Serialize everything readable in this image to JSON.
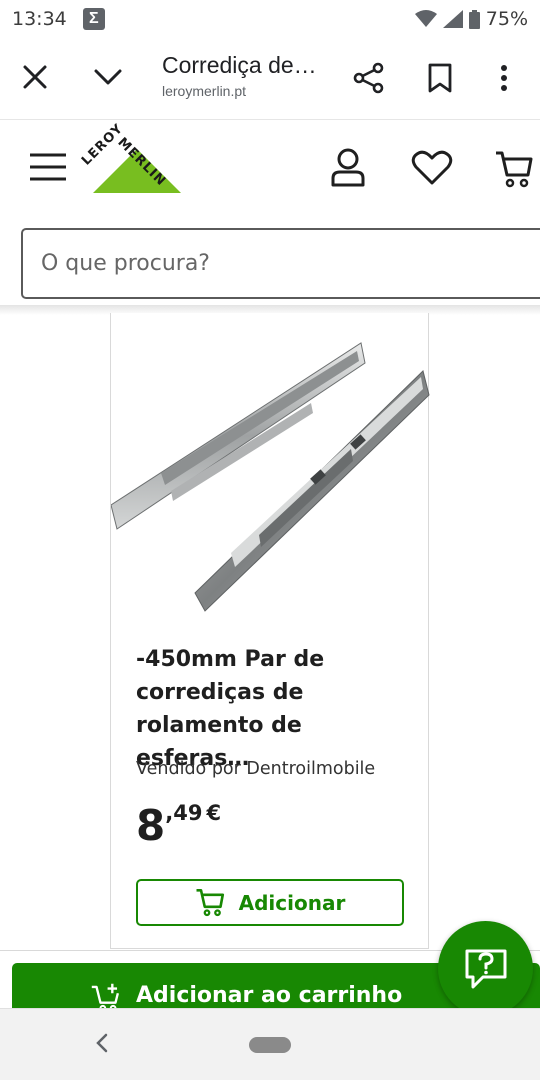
{
  "status_bar": {
    "time": "13:34",
    "notification_icon": "sigma-icon",
    "battery": "75%"
  },
  "browser": {
    "title": "Corrediça de…",
    "url": "leroymerlin.pt",
    "icons": [
      "close-icon",
      "chevron-down-icon",
      "share-icon",
      "bookmark-icon",
      "more-vert-icon"
    ]
  },
  "site": {
    "logo_top": "MERLIN",
    "logo_left": "LEROY",
    "search_placeholder": "O que procura?",
    "brand_color": "#188803",
    "logo_color": "#78be20"
  },
  "product": {
    "title": "-450mm Par de corrediças de rolamento de esferas…",
    "seller": "Vendido por Dentroilmobile",
    "price_int": "8",
    "price_dec": ",49",
    "currency": "€",
    "add_label": "Adicionar"
  },
  "sticky": {
    "add_to_cart_label": "Adicionar ao carrinho"
  }
}
